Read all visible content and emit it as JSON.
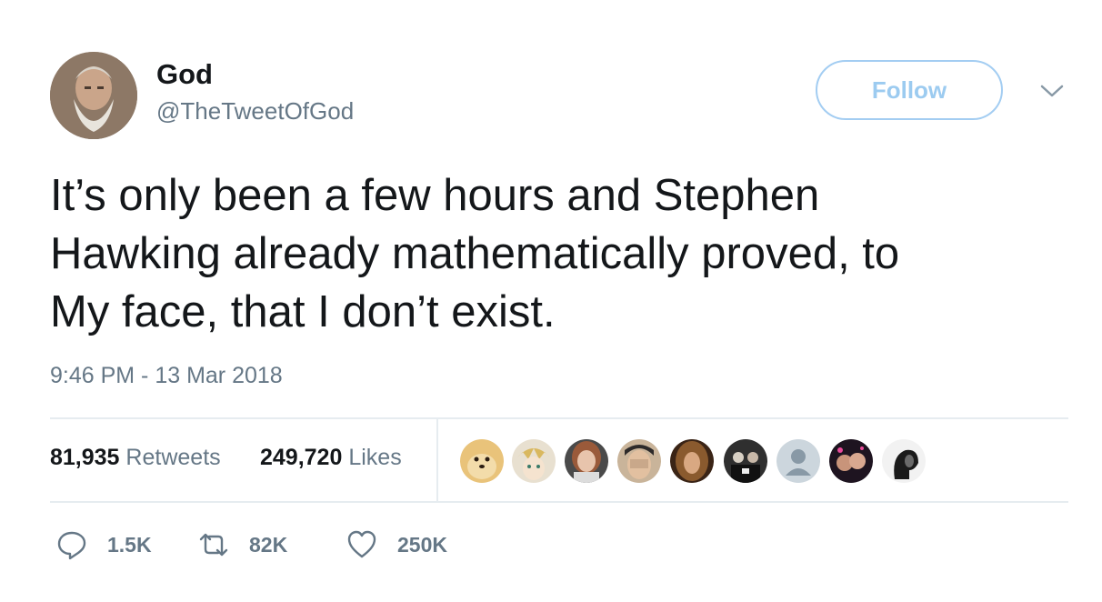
{
  "author": {
    "name": "God",
    "handle": "@TheTweetOfGod"
  },
  "follow_label": "Follow",
  "tweet": {
    "text": "It’s only been a few hours and Stephen\nHawking already mathematically proved, to\nMy face, that I don’t exist.",
    "timestamp": "9:46 PM - 13 Mar 2018"
  },
  "stats": {
    "retweets": {
      "count": "81,935",
      "label": "Retweets"
    },
    "likes": {
      "count": "249,720",
      "label": "Likes"
    }
  },
  "likers": [
    {
      "icon": "doge-avatar"
    },
    {
      "icon": "anime-avatar"
    },
    {
      "icon": "woman-avatar"
    },
    {
      "icon": "man-face-avatar"
    },
    {
      "icon": "woman-hair-avatar"
    },
    {
      "icon": "group-avatar"
    },
    {
      "icon": "default-avatar"
    },
    {
      "icon": "selfie-avatar"
    },
    {
      "icon": "profile-avatar"
    }
  ],
  "actions": {
    "reply": {
      "icon": "reply-icon",
      "count": "1.5K"
    },
    "retweet": {
      "icon": "retweet-icon",
      "count": "82K"
    },
    "like": {
      "icon": "heart-icon",
      "count": "250K"
    }
  },
  "colors": {
    "text": "#14171a",
    "secondary": "#657786",
    "follow_blue": "#9ccbf0",
    "divider": "#e6ecf0"
  }
}
